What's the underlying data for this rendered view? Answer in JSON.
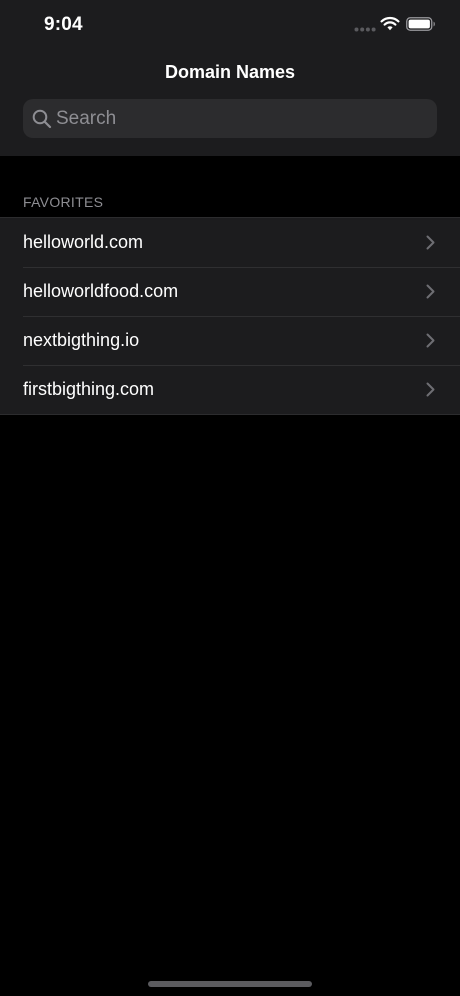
{
  "status_bar": {
    "time": "9:04"
  },
  "nav": {
    "title": "Domain Names"
  },
  "search": {
    "placeholder": "Search",
    "value": ""
  },
  "favorites": {
    "header": "FAVORITES",
    "items": [
      {
        "label": "helloworld.com"
      },
      {
        "label": "helloworldfood.com"
      },
      {
        "label": "nextbigthing.io"
      },
      {
        "label": "firstbigthing.com"
      }
    ]
  },
  "colors": {
    "background": "#000000",
    "surface": "#1c1c1e",
    "search_fill": "#2c2c2e",
    "secondary_text": "#8e8e93",
    "chevron": "#6e6e73"
  },
  "icons": {
    "status": [
      "cellular-dots-icon",
      "wifi-icon",
      "battery-icon"
    ],
    "search": "search-icon",
    "disclosure": "chevron-right-icon"
  }
}
